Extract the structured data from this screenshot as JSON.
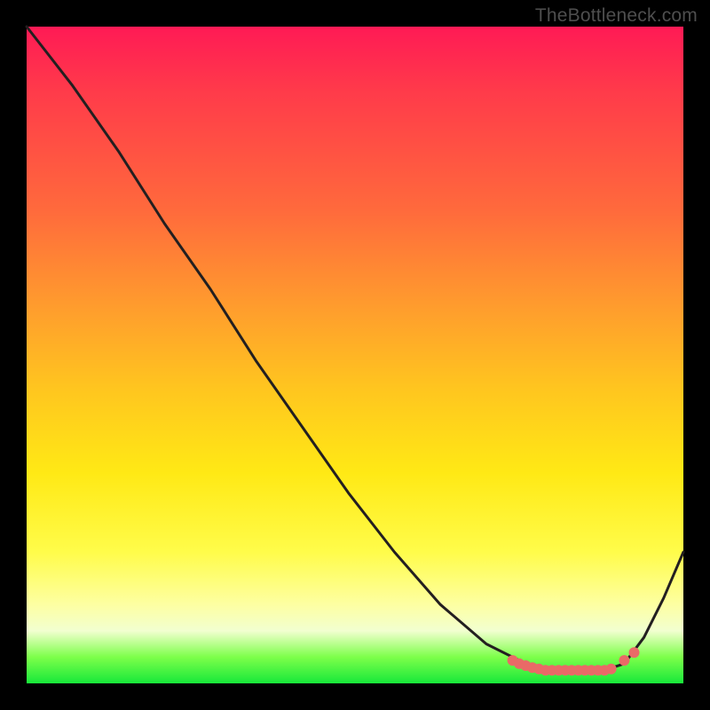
{
  "attribution": "TheBottleneck.com",
  "colors": {
    "frame": "#000000",
    "curve": "#231f20",
    "marker": "#e96a67",
    "gradient_top": "#ff1a55",
    "gradient_bottom": "#17e83a"
  },
  "chart_data": {
    "type": "line",
    "title": "",
    "xlabel": "",
    "ylabel": "",
    "xlim": [
      0,
      100
    ],
    "ylim": [
      0,
      100
    ],
    "note": "Axes are unlabeled; values are read as percent of panel width (x) and percent of panel height from top (y).",
    "series": [
      {
        "name": "bottleneck-curve",
        "x": [
          0,
          7,
          14,
          21,
          28,
          35,
          42,
          49,
          56,
          63,
          70,
          76,
          79,
          82,
          85,
          88,
          91,
          94,
          97,
          100
        ],
        "y": [
          0,
          9,
          19,
          30,
          40,
          51,
          61,
          71,
          80,
          88,
          94,
          97,
          98,
          98,
          98,
          98,
          97,
          93,
          87,
          80
        ]
      }
    ],
    "markers": {
      "name": "highlight-band",
      "style": "thick-salmon-dots",
      "x": [
        74,
        75,
        76,
        77,
        78,
        79,
        80,
        81,
        82,
        83,
        84,
        85,
        86,
        87,
        88,
        89,
        91,
        92.5
      ],
      "y": [
        96.5,
        97,
        97.3,
        97.6,
        97.8,
        98,
        98,
        98,
        98,
        98,
        98,
        98,
        98,
        98,
        98,
        97.8,
        96.5,
        95.3
      ]
    }
  }
}
